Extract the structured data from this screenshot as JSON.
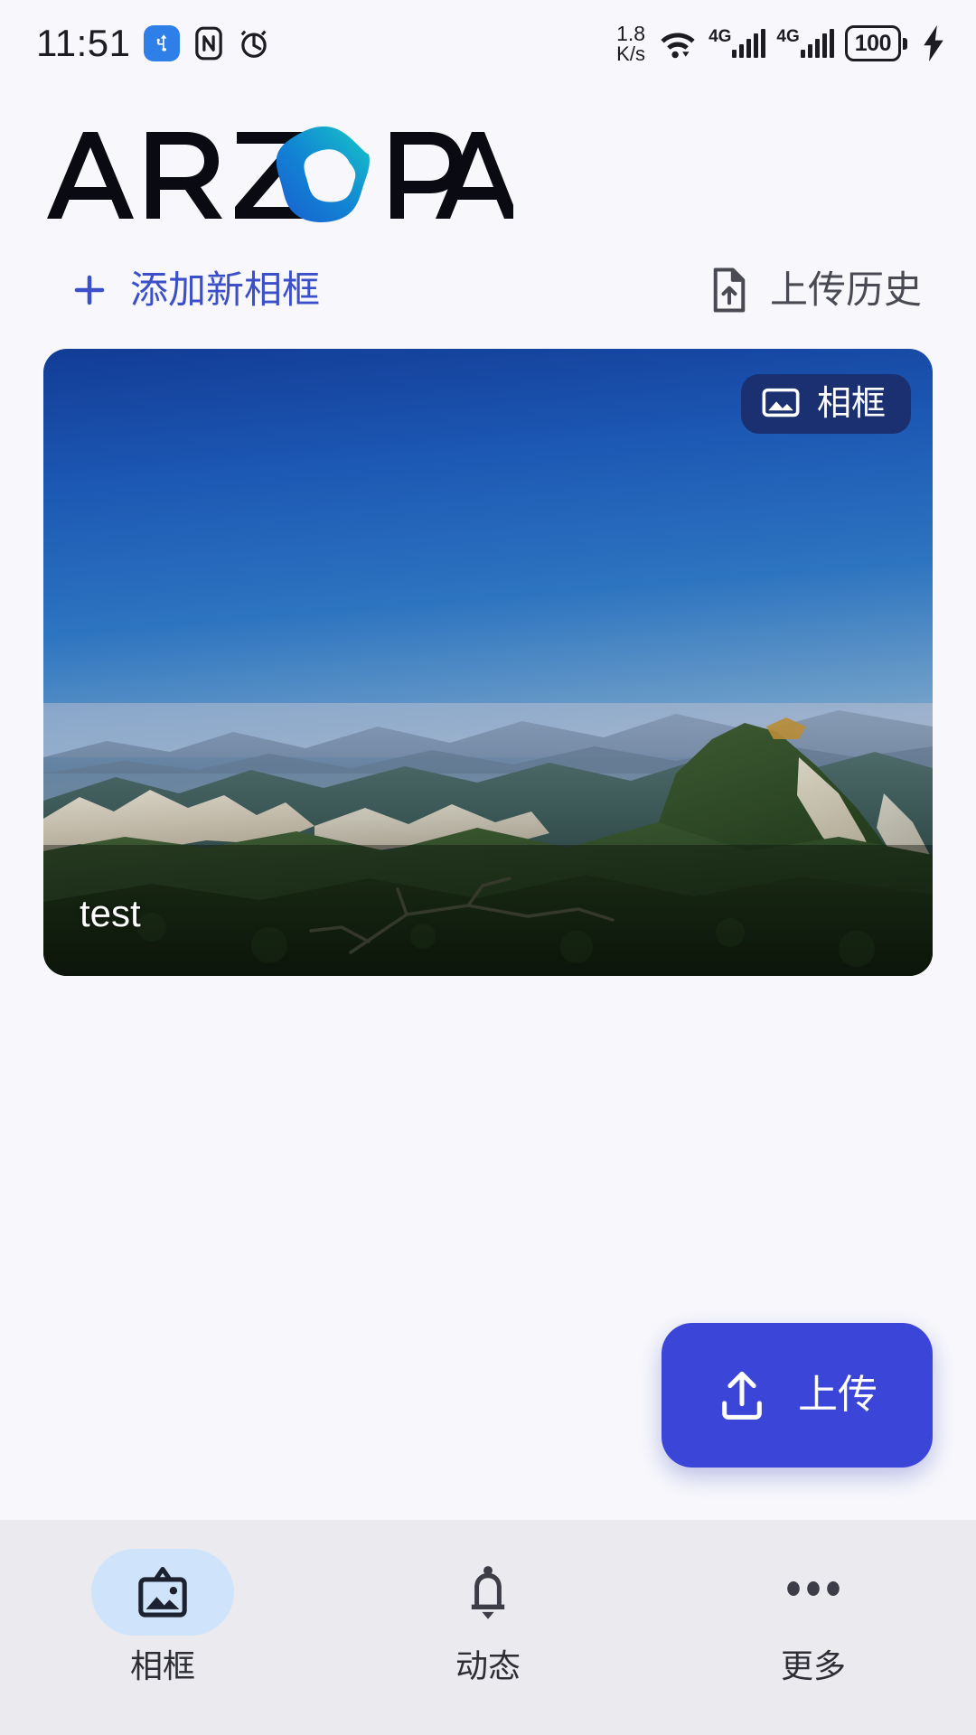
{
  "status_bar": {
    "time": "11:51",
    "icons_left": [
      "usb-icon",
      "nfc-icon",
      "alarm-icon"
    ],
    "network_speed_value": "1.8",
    "network_speed_unit": "K/s",
    "wifi": "wifi-icon",
    "sim1_network": "4G",
    "sim2_network": "4G",
    "battery_percent": "100",
    "charging": "charging-bolt-icon"
  },
  "brand": {
    "name": "ARZOPA",
    "letters_before": "ARZ",
    "letters_after": "PA",
    "logo_gradient_from": "#16c7c8",
    "logo_gradient_to": "#1a5fd0"
  },
  "actions": {
    "add_frame_label": "添加新相框",
    "add_frame_icon": "plus-icon",
    "add_frame_color": "#3b50c8",
    "upload_history_label": "上传历史",
    "upload_history_icon": "file-upload-icon",
    "upload_history_color": "#4a4a55"
  },
  "frames": [
    {
      "title": "test",
      "badge_label": "相框",
      "badge_icon": "image-icon",
      "badge_bg": "#1b3070"
    }
  ],
  "fab": {
    "label": "上传",
    "icon": "upload-icon",
    "bg": "#3b46d8"
  },
  "bottom_nav": {
    "items": [
      {
        "label": "相框",
        "icon": "photo-frame-icon",
        "active": true,
        "pill_bg": "#cfe4fb"
      },
      {
        "label": "动态",
        "icon": "bell-icon",
        "active": false,
        "pill_bg": ""
      },
      {
        "label": "更多",
        "icon": "more-dots-icon",
        "active": false,
        "pill_bg": ""
      }
    ]
  },
  "theme": {
    "page_bg": "#f8f8fc",
    "nav_bg": "#ebebef",
    "accent": "#3b46d8"
  }
}
